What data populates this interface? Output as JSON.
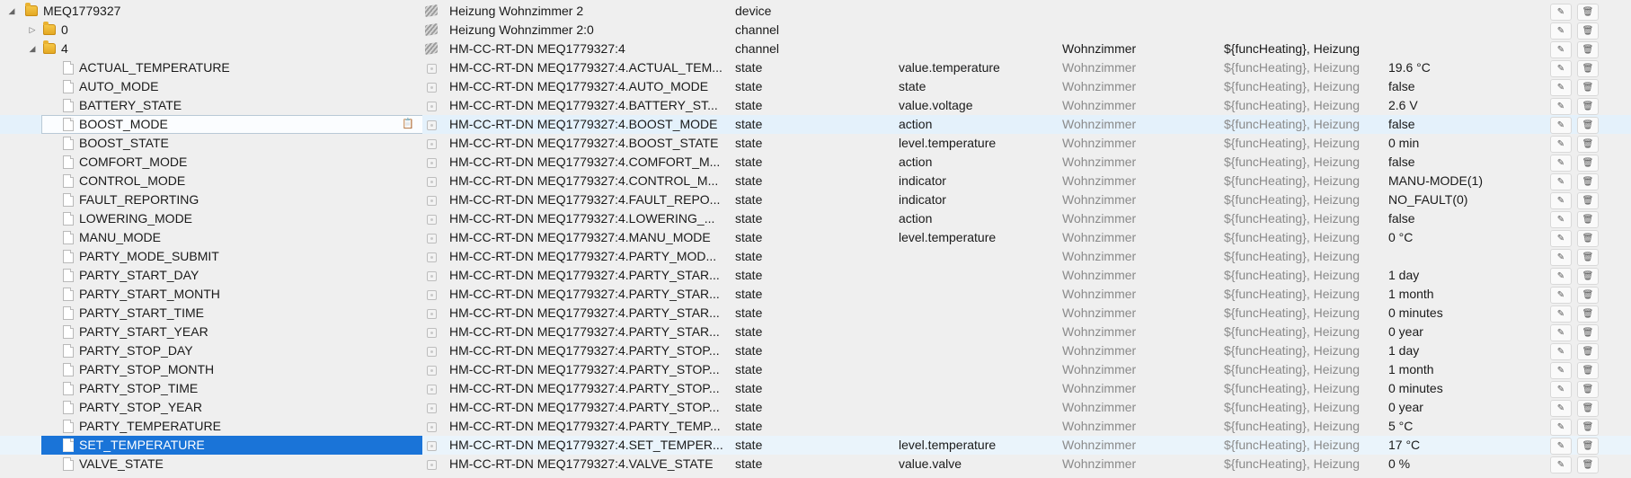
{
  "device_row": {
    "name": "MEQ1779327",
    "object": "Heizung Wohnzimmer 2",
    "type": "device"
  },
  "channel0_row": {
    "name": "0",
    "object": "Heizung Wohnzimmer 2:0",
    "type": "channel"
  },
  "channel4_row": {
    "name": "4",
    "object": "HM-CC-RT-DN MEQ1779327:4",
    "type": "channel",
    "room": "Wohnzimmer",
    "function": "${funcHeating}, Heizung"
  },
  "states": [
    {
      "name": "ACTUAL_TEMPERATURE",
      "object": "HM-CC-RT-DN MEQ1779327:4.ACTUAL_TEM...",
      "type": "state",
      "role": "value.temperature",
      "room": "Wohnzimmer",
      "function": "${funcHeating}, Heizung",
      "value": "19.6 °C"
    },
    {
      "name": "AUTO_MODE",
      "object": "HM-CC-RT-DN MEQ1779327:4.AUTO_MODE",
      "type": "state",
      "role": "state",
      "room": "Wohnzimmer",
      "function": "${funcHeating}, Heizung",
      "value": "false"
    },
    {
      "name": "BATTERY_STATE",
      "object": "HM-CC-RT-DN MEQ1779327:4.BATTERY_ST...",
      "type": "state",
      "role": "value.voltage",
      "room": "Wohnzimmer",
      "function": "${funcHeating}, Heizung",
      "value": "2.6 V"
    },
    {
      "name": "BOOST_MODE",
      "object": "HM-CC-RT-DN MEQ1779327:4.BOOST_MODE",
      "type": "state",
      "role": "action",
      "room": "Wohnzimmer",
      "function": "${funcHeating}, Heizung",
      "value": "false"
    },
    {
      "name": "BOOST_STATE",
      "object": "HM-CC-RT-DN MEQ1779327:4.BOOST_STATE",
      "type": "state",
      "role": "level.temperature",
      "room": "Wohnzimmer",
      "function": "${funcHeating}, Heizung",
      "value": "0 min"
    },
    {
      "name": "COMFORT_MODE",
      "object": "HM-CC-RT-DN MEQ1779327:4.COMFORT_M...",
      "type": "state",
      "role": "action",
      "room": "Wohnzimmer",
      "function": "${funcHeating}, Heizung",
      "value": "false"
    },
    {
      "name": "CONTROL_MODE",
      "object": "HM-CC-RT-DN MEQ1779327:4.CONTROL_M...",
      "type": "state",
      "role": "indicator",
      "room": "Wohnzimmer",
      "function": "${funcHeating}, Heizung",
      "value": "MANU-MODE(1)"
    },
    {
      "name": "FAULT_REPORTING",
      "object": "HM-CC-RT-DN MEQ1779327:4.FAULT_REPO...",
      "type": "state",
      "role": "indicator",
      "room": "Wohnzimmer",
      "function": "${funcHeating}, Heizung",
      "value": "NO_FAULT(0)"
    },
    {
      "name": "LOWERING_MODE",
      "object": "HM-CC-RT-DN MEQ1779327:4.LOWERING_...",
      "type": "state",
      "role": "action",
      "room": "Wohnzimmer",
      "function": "${funcHeating}, Heizung",
      "value": "false"
    },
    {
      "name": "MANU_MODE",
      "object": "HM-CC-RT-DN MEQ1779327:4.MANU_MODE",
      "type": "state",
      "role": "level.temperature",
      "room": "Wohnzimmer",
      "function": "${funcHeating}, Heizung",
      "value": "0 °C"
    },
    {
      "name": "PARTY_MODE_SUBMIT",
      "object": "HM-CC-RT-DN MEQ1779327:4.PARTY_MOD...",
      "type": "state",
      "role": "",
      "room": "Wohnzimmer",
      "function": "${funcHeating}, Heizung",
      "value": ""
    },
    {
      "name": "PARTY_START_DAY",
      "object": "HM-CC-RT-DN MEQ1779327:4.PARTY_STAR...",
      "type": "state",
      "role": "",
      "room": "Wohnzimmer",
      "function": "${funcHeating}, Heizung",
      "value": "1 day"
    },
    {
      "name": "PARTY_START_MONTH",
      "object": "HM-CC-RT-DN MEQ1779327:4.PARTY_STAR...",
      "type": "state",
      "role": "",
      "room": "Wohnzimmer",
      "function": "${funcHeating}, Heizung",
      "value": "1 month"
    },
    {
      "name": "PARTY_START_TIME",
      "object": "HM-CC-RT-DN MEQ1779327:4.PARTY_STAR...",
      "type": "state",
      "role": "",
      "room": "Wohnzimmer",
      "function": "${funcHeating}, Heizung",
      "value": "0 minutes"
    },
    {
      "name": "PARTY_START_YEAR",
      "object": "HM-CC-RT-DN MEQ1779327:4.PARTY_STAR...",
      "type": "state",
      "role": "",
      "room": "Wohnzimmer",
      "function": "${funcHeating}, Heizung",
      "value": "0 year"
    },
    {
      "name": "PARTY_STOP_DAY",
      "object": "HM-CC-RT-DN MEQ1779327:4.PARTY_STOP...",
      "type": "state",
      "role": "",
      "room": "Wohnzimmer",
      "function": "${funcHeating}, Heizung",
      "value": "1 day"
    },
    {
      "name": "PARTY_STOP_MONTH",
      "object": "HM-CC-RT-DN MEQ1779327:4.PARTY_STOP...",
      "type": "state",
      "role": "",
      "room": "Wohnzimmer",
      "function": "${funcHeating}, Heizung",
      "value": "1 month"
    },
    {
      "name": "PARTY_STOP_TIME",
      "object": "HM-CC-RT-DN MEQ1779327:4.PARTY_STOP...",
      "type": "state",
      "role": "",
      "room": "Wohnzimmer",
      "function": "${funcHeating}, Heizung",
      "value": "0 minutes"
    },
    {
      "name": "PARTY_STOP_YEAR",
      "object": "HM-CC-RT-DN MEQ1779327:4.PARTY_STOP...",
      "type": "state",
      "role": "",
      "room": "Wohnzimmer",
      "function": "${funcHeating}, Heizung",
      "value": "0 year"
    },
    {
      "name": "PARTY_TEMPERATURE",
      "object": "HM-CC-RT-DN MEQ1779327:4.PARTY_TEMP...",
      "type": "state",
      "role": "",
      "room": "Wohnzimmer",
      "function": "${funcHeating}, Heizung",
      "value": "5 °C"
    },
    {
      "name": "SET_TEMPERATURE",
      "object": "HM-CC-RT-DN MEQ1779327:4.SET_TEMPER...",
      "type": "state",
      "role": "level.temperature",
      "room": "Wohnzimmer",
      "function": "${funcHeating}, Heizung",
      "value": "17 °C"
    },
    {
      "name": "VALVE_STATE",
      "object": "HM-CC-RT-DN MEQ1779327:4.VALVE_STATE",
      "type": "state",
      "role": "value.valve",
      "room": "Wohnzimmer",
      "function": "${funcHeating}, Heizung",
      "value": "0 %"
    }
  ],
  "icons": {
    "edit": "pencil-icon",
    "delete": "trash-icon",
    "copy": "clipboard-icon"
  },
  "highlight": {
    "hover_index": 3,
    "selected_index": 20,
    "selection_color": "#1a74d8"
  }
}
